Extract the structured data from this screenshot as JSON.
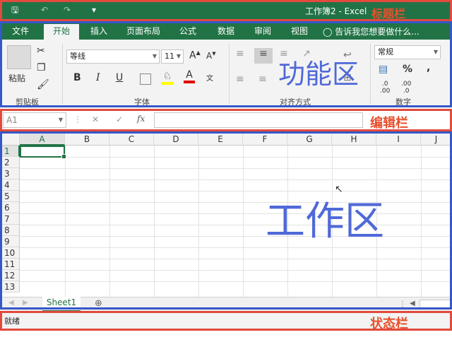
{
  "titlebar": {
    "save_icon": "save-icon",
    "undo_icon": "undo-icon",
    "redo_icon": "redo-icon",
    "customize_icon": "customize-qat-icon",
    "title": "工作簿2 - Excel"
  },
  "tabs": [
    "文件",
    "开始",
    "插入",
    "页面布局",
    "公式",
    "数据",
    "审阅",
    "视图"
  ],
  "active_tab": "开始",
  "tell_me": "告诉我您想要做什么...",
  "ribbon": {
    "clipboard": {
      "paste": "粘贴",
      "label": "剪贴板"
    },
    "font": {
      "name": "等线",
      "size": "11",
      "label": "字体"
    },
    "alignment": {
      "label": "对齐方式"
    },
    "number": {
      "format": "常规",
      "label": "数字"
    }
  },
  "formula_bar": {
    "name_box": "A1",
    "fx": "fx",
    "cancel": "✕",
    "enter": "✓"
  },
  "grid": {
    "columns": [
      "A",
      "B",
      "C",
      "D",
      "E",
      "F",
      "G",
      "H",
      "I",
      "J"
    ],
    "rows": [
      "1",
      "2",
      "3",
      "4",
      "5",
      "6",
      "7",
      "8",
      "9",
      "10",
      "11",
      "12",
      "13"
    ],
    "selected_cell": "A1"
  },
  "sheets": {
    "tabs": [
      "Sheet1"
    ],
    "active": "Sheet1",
    "add": "⊕"
  },
  "status": {
    "text": "就绪"
  },
  "annotations": {
    "title": "标题栏",
    "ribbon": "功能区",
    "formula": "编辑栏",
    "work": "工作区",
    "status": "状态栏"
  },
  "colors": {
    "excel_green": "#217346",
    "red_frame": "#e14a3c",
    "blue_frame": "#3558c8",
    "annotation_blue": "#5069d8"
  }
}
